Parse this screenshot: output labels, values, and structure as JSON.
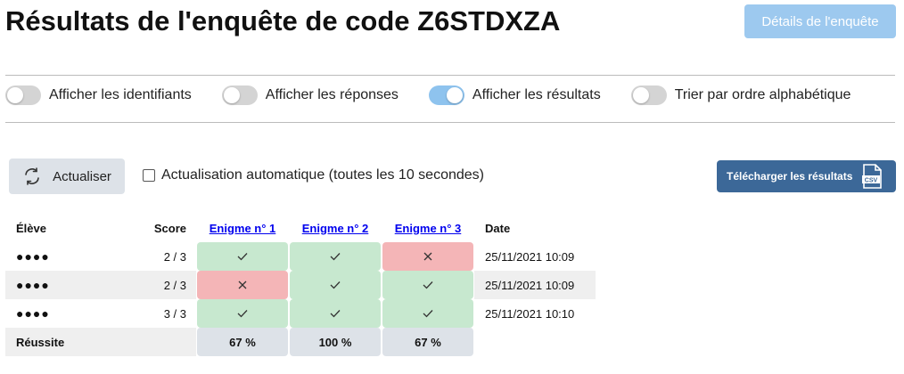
{
  "title": "Résultats de l'enquête de code Z6STDXZA",
  "details_button": "Détails de l'enquête",
  "toggles": [
    {
      "label": "Afficher les identifiants",
      "on": false
    },
    {
      "label": "Afficher les réponses",
      "on": false
    },
    {
      "label": "Afficher les résultats",
      "on": true
    },
    {
      "label": "Trier par ordre alphabétique",
      "on": false
    }
  ],
  "refresh_button": "Actualiser",
  "auto_refresh": {
    "label": "Actualisation automatique (toutes les 10 secondes)",
    "checked": false
  },
  "download_button": "Télécharger les résultats",
  "download_icon_text": "CSV",
  "table": {
    "headers": {
      "student": "Élève",
      "score": "Score",
      "enigmas": [
        "Enigme n° 1",
        "Enigme n° 2",
        "Enigme n° 3"
      ],
      "date": "Date"
    },
    "rows": [
      {
        "student": "●●●●",
        "score": "2 / 3",
        "results": [
          "correct",
          "correct",
          "incorrect"
        ],
        "date": "25/11/2021 10:09"
      },
      {
        "student": "●●●●",
        "score": "2 / 3",
        "results": [
          "incorrect",
          "correct",
          "correct"
        ],
        "date": "25/11/2021 10:09"
      },
      {
        "student": "●●●●",
        "score": "3 / 3",
        "results": [
          "correct",
          "correct",
          "correct"
        ],
        "date": "25/11/2021 10:10"
      }
    ],
    "footer": {
      "label": "Réussite",
      "values": [
        "67 %",
        "100 %",
        "67 %"
      ]
    }
  },
  "colors": {
    "correct": "#c7e8cf",
    "incorrect": "#f4b5b7",
    "accent": "#3c6898",
    "toggle_on": "#8ec3ee"
  },
  "icons": {
    "correct": "check-icon",
    "incorrect": "cross-icon"
  }
}
